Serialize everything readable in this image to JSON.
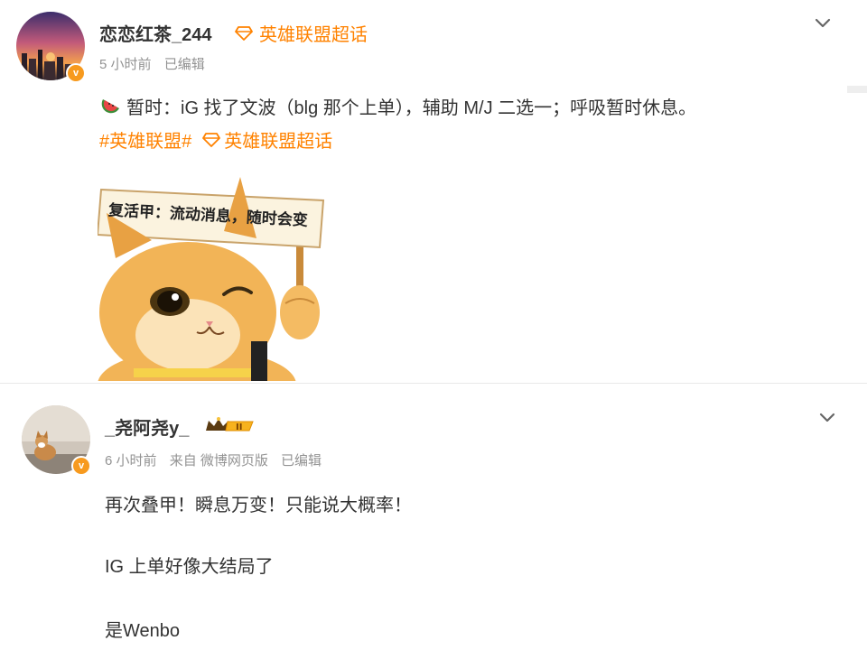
{
  "post1": {
    "username": "恋恋红茶_244",
    "super_topic": "英雄联盟超话",
    "time": "5 小时前",
    "edited": "已编辑",
    "emoji_icon": "watermelon-icon",
    "content": "暂时：iG 找了文波（blg 那个上单），辅助 M/J 二选一；呼吸暂时休息。",
    "hashtag": "#英雄联盟#",
    "hashtag_super": "英雄联盟超话",
    "sticker_sign": "复活甲：流动消息，随时会变"
  },
  "post2": {
    "username": "_尧阿尧y_",
    "level": "II",
    "time": "6 小时前",
    "source": "来自 微博网页版",
    "edited": "已编辑",
    "lines": [
      "再次叠甲！瞬息万变！只能说大概率！",
      "IG 上单好像大结局了",
      "是Wenbo"
    ]
  },
  "colors": {
    "accent": "#ff8200",
    "meta": "#939393",
    "text": "#333333",
    "verified": "#f79a1e"
  }
}
